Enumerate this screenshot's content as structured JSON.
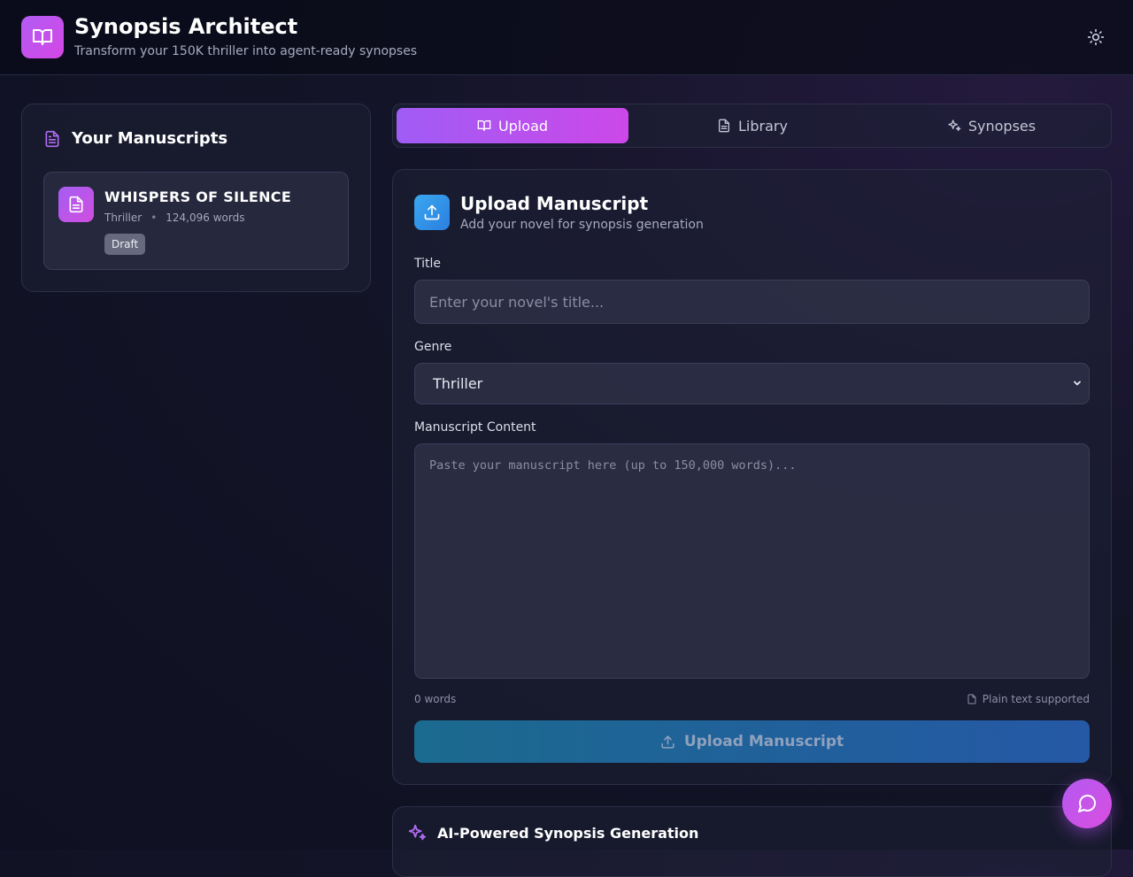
{
  "header": {
    "title": "Synopsis Architect",
    "subtitle": "Transform your 150K thriller into agent-ready synopses",
    "logo_icon": "book-open-icon",
    "theme_icon": "sun-icon"
  },
  "sidebar": {
    "heading": "Your Manuscripts",
    "heading_icon": "document-icon",
    "manuscripts": [
      {
        "title": "WHISPERS OF SILENCE",
        "genre": "Thriller",
        "separator": "•",
        "words": "124,096 words",
        "status": "Draft",
        "icon": "document-icon"
      }
    ]
  },
  "tabs": [
    {
      "label": "Upload",
      "icon": "book-open-icon",
      "active": true
    },
    {
      "label": "Library",
      "icon": "document-icon",
      "active": false
    },
    {
      "label": "Synopses",
      "icon": "sparkles-icon",
      "active": false
    }
  ],
  "upload": {
    "icon": "upload-icon",
    "title": "Upload Manuscript",
    "subtitle": "Add your novel for synopsis generation",
    "title_label": "Title",
    "title_placeholder": "Enter your novel's title...",
    "title_value": "",
    "genre_label": "Genre",
    "genre_value": "Thriller",
    "content_label": "Manuscript Content",
    "content_placeholder": "Paste your manuscript here (up to 150,000 words)...",
    "content_value": "",
    "word_count": "0 words",
    "format_note": "Plain text supported",
    "button_label": "Upload Manuscript"
  },
  "ai_section": {
    "heading": "AI-Powered Synopsis Generation",
    "icon": "sparkles-icon"
  },
  "chat": {
    "icon": "chat-bubble-icon"
  },
  "colors": {
    "accent_purple": "#b15cf3",
    "accent_pink": "#d547e6",
    "accent_blue": "#2b7fe0",
    "background": "#131427"
  }
}
